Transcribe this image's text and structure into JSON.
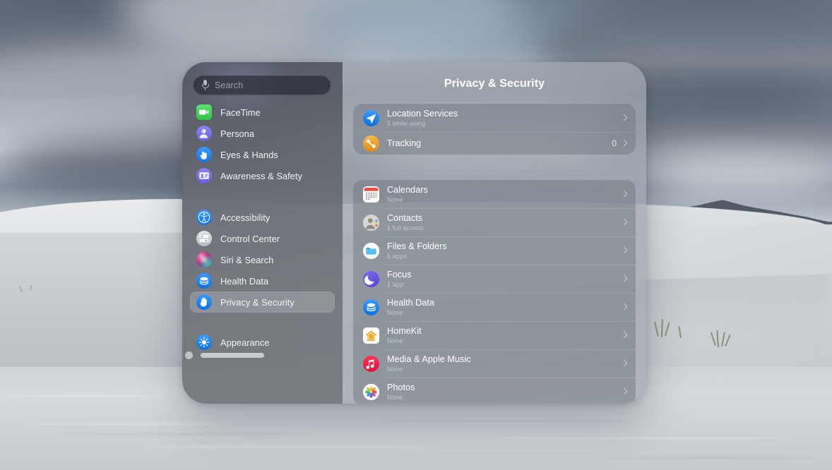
{
  "window": {
    "chrome": {
      "close_label": "Close",
      "resize_label": "Resize"
    }
  },
  "sidebar": {
    "search": {
      "placeholder": "Search",
      "value": "",
      "mic_icon": "microphone-icon"
    },
    "items": [
      {
        "label": "FaceTime",
        "icon": "facetime-icon",
        "selected": false
      },
      {
        "label": "Persona",
        "icon": "persona-icon",
        "selected": false
      },
      {
        "label": "Eyes & Hands",
        "icon": "eyes-and-hands-icon",
        "selected": false
      },
      {
        "label": "Awareness & Safety",
        "icon": "awareness-safety-icon",
        "selected": false
      },
      {
        "label": "Accessibility",
        "icon": "accessibility-icon",
        "selected": false
      },
      {
        "label": "Control Center",
        "icon": "control-center-icon",
        "selected": false
      },
      {
        "label": "Siri & Search",
        "icon": "siri-icon",
        "selected": false
      },
      {
        "label": "Health Data",
        "icon": "health-data-icon",
        "selected": false
      },
      {
        "label": "Privacy & Security",
        "icon": "privacy-security-icon",
        "selected": true
      },
      {
        "label": "Appearance",
        "icon": "appearance-icon",
        "selected": false
      }
    ]
  },
  "main": {
    "title": "Privacy & Security",
    "groups": [
      {
        "rows": [
          {
            "label": "Location Services",
            "detail": "5 while using",
            "value": "",
            "icon": "location-services-icon"
          },
          {
            "label": "Tracking",
            "detail": "",
            "value": "0",
            "icon": "tracking-icon"
          }
        ]
      },
      {
        "rows": [
          {
            "label": "Calendars",
            "detail": "None",
            "value": "",
            "icon": "calendar-icon"
          },
          {
            "label": "Contacts",
            "detail": "1 full access",
            "value": "",
            "icon": "contacts-icon"
          },
          {
            "label": "Files & Folders",
            "detail": "5 apps",
            "value": "",
            "icon": "files-folders-icon"
          },
          {
            "label": "Focus",
            "detail": "1 app",
            "value": "",
            "icon": "focus-icon"
          },
          {
            "label": "Health Data",
            "detail": "None",
            "value": "",
            "icon": "health-data-icon"
          },
          {
            "label": "HomeKit",
            "detail": "None",
            "value": "",
            "icon": "homekit-icon"
          },
          {
            "label": "Media & Apple Music",
            "detail": "None",
            "value": "",
            "icon": "media-apple-music-icon"
          },
          {
            "label": "Photos",
            "detail": "None",
            "value": "",
            "icon": "photos-icon"
          }
        ]
      }
    ]
  },
  "colors": {
    "accent_blue": "#0a84ff",
    "facetime_green": "#4cd964",
    "persona_purple": "#7d7aea",
    "tracking_orange": "#f0a030",
    "media_red": "#f22b48",
    "homekit_orange": "#f5a623",
    "sidebar_bg": "#6e7176",
    "panel_bg": "#888e96",
    "selected_row": "#ced2d8"
  }
}
